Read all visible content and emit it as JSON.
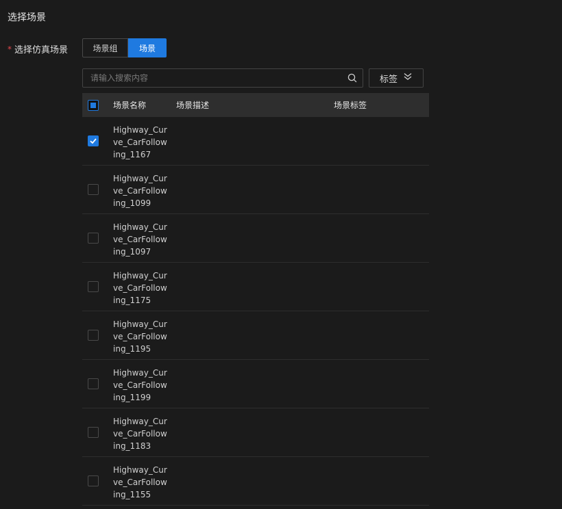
{
  "section_title": "选择场景",
  "form": {
    "required_mark": "*",
    "label": "选择仿真场景",
    "tabs": [
      "场景组",
      "场景"
    ],
    "active_tab": 1
  },
  "search": {
    "placeholder": "请输入搜索内容",
    "value": ""
  },
  "tag_button": {
    "label": "标签"
  },
  "table": {
    "headers": [
      "场景名称",
      "场景描述",
      "场景标签"
    ],
    "select_all_state": "indeterminate",
    "rows": [
      {
        "name": "Highway_Curve_CarFollowing_1167",
        "checked": true
      },
      {
        "name": "Highway_Curve_CarFollowing_1099",
        "checked": false
      },
      {
        "name": "Highway_Curve_CarFollowing_1097",
        "checked": false
      },
      {
        "name": "Highway_Curve_CarFollowing_1175",
        "checked": false
      },
      {
        "name": "Highway_Curve_CarFollowing_1195",
        "checked": false
      },
      {
        "name": "Highway_Curve_CarFollowing_1199",
        "checked": false
      },
      {
        "name": "Highway_Curve_CarFollowing_1183",
        "checked": false
      },
      {
        "name": "Highway_Curve_CarFollowing_1155",
        "checked": false
      }
    ]
  },
  "colors": {
    "accent": "#1f7ae0",
    "background": "#1b1b1b",
    "header_bg": "#2e2e2e",
    "required": "#e5484d"
  },
  "icons": {
    "search": "search-icon",
    "expand": "double-chevron-down-icon",
    "check": "check-icon"
  }
}
